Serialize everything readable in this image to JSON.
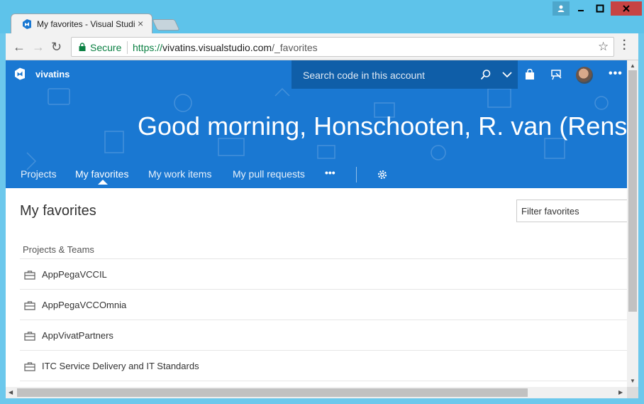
{
  "browser": {
    "tab_title": "My favorites - Visual Studio",
    "close_glyph": "×",
    "secure_label": "Secure",
    "url_scheme": "https://",
    "url_host": "vivatins.visualstudio.com",
    "url_path": "/_favorites",
    "star_glyph": "☆",
    "back_glyph": "←",
    "forward_glyph": "→",
    "reload_glyph": "↻"
  },
  "header": {
    "account_name": "vivatins",
    "search_placeholder": "Search code in this account",
    "more_glyph": "•••"
  },
  "hero": {
    "greeting": "Good morning, Honschooten, R. van (Rens)"
  },
  "hub_nav": {
    "items": [
      {
        "label": "Projects"
      },
      {
        "label": "My favorites"
      },
      {
        "label": "My work items"
      },
      {
        "label": "My pull requests"
      }
    ],
    "more_glyph": "•••"
  },
  "main": {
    "title": "My favorites",
    "filter_placeholder": "Filter favorites",
    "section_label": "Projects & Teams",
    "favorites": [
      {
        "label": "AppPegaVCCIL"
      },
      {
        "label": "AppPegaVCCOmnia"
      },
      {
        "label": "AppVivatPartners"
      },
      {
        "label": "ITC Service Delivery and IT Standards"
      }
    ]
  },
  "colors": {
    "hero_blue": "#1a78d2",
    "search_blue": "#0f5ea8",
    "secure_green": "#0b8043",
    "window_frame": "#5ec3ea"
  }
}
